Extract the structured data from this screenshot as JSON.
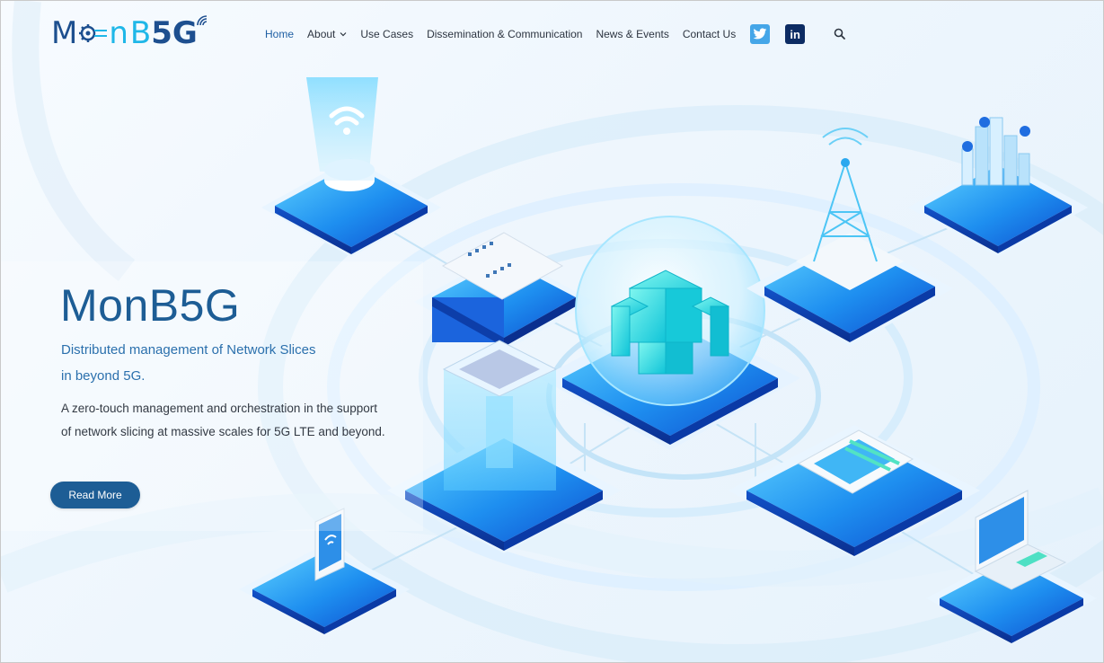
{
  "header": {
    "logo": {
      "letter_m": "M",
      "letter_n": "n",
      "letter_b": "B",
      "letters_5g": "5G"
    },
    "nav": [
      {
        "label": "Home",
        "active": true
      },
      {
        "label": "About",
        "has_dropdown": true
      },
      {
        "label": "Use Cases"
      },
      {
        "label": "Dissemination & Communication"
      },
      {
        "label": "News & Events"
      },
      {
        "label": "Contact Us"
      }
    ],
    "social": {
      "twitter_icon": "twitter-icon",
      "linkedin_label": "in"
    },
    "search_icon": "search-icon"
  },
  "hero": {
    "title": "MonB5G",
    "subtitle_line1": "Distributed management of Network Slices",
    "subtitle_line2": "in beyond 5G.",
    "description_line1": "A zero-touch management and orchestration in the support",
    "description_line2": "of network slicing at massive scales for 5G LTE and beyond.",
    "button_label": "Read More"
  },
  "colors": {
    "brand_dark": "#1d5d95",
    "brand_light": "#1fb7e8",
    "twitter": "#45a6e8",
    "linkedin": "#0c2b63"
  }
}
